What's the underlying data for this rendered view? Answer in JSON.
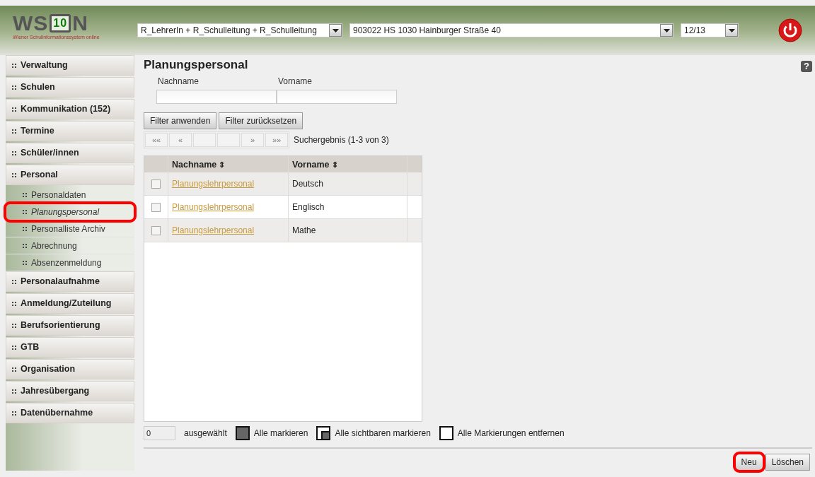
{
  "header": {
    "logo": {
      "text_left": "WS",
      "badge": "10",
      "text_right": "N",
      "tagline": "Wiener Schulinformationssystem online"
    },
    "selects": [
      {
        "value": "R_LehrerIn + R_Schulleitung + R_Schulleitung"
      },
      {
        "value": "903022 HS 1030 Hainburger Straße 40"
      },
      {
        "value": "12/13"
      }
    ]
  },
  "sidebar": {
    "items": [
      {
        "label": "Verwaltung",
        "selected": false
      },
      {
        "label": "Schulen",
        "selected": false
      },
      {
        "label": "Kommunikation (152)",
        "selected": false
      },
      {
        "label": "Termine",
        "selected": false
      },
      {
        "label": "Schüler/innen",
        "selected": false
      },
      {
        "label": "Personal",
        "selected": false,
        "children": [
          {
            "label": "Personaldaten",
            "selected": false,
            "highlighted": false
          },
          {
            "label": "Planungspersonal",
            "selected": true,
            "highlighted": true
          },
          {
            "label": "Personalliste Archiv",
            "selected": false,
            "highlighted": false
          },
          {
            "label": "Abrechnung",
            "selected": false,
            "highlighted": false
          },
          {
            "label": "Absenzenmeldung",
            "selected": false,
            "highlighted": false
          }
        ]
      },
      {
        "label": "Personalaufnahme",
        "selected": false
      },
      {
        "label": "Anmeldung/Zuteilung",
        "selected": false
      },
      {
        "label": "Berufsorientierung",
        "selected": false
      },
      {
        "label": "GTB",
        "selected": false
      },
      {
        "label": "Organisation",
        "selected": false
      },
      {
        "label": "Jahresübergang",
        "selected": false
      },
      {
        "label": "Datenübernahme",
        "selected": false
      }
    ]
  },
  "main": {
    "title": "Planungspersonal",
    "help": "?",
    "filters": [
      {
        "label": "Nachname"
      },
      {
        "label": "Vorname"
      }
    ],
    "filter_buttons": [
      "Filter anwenden",
      "Filter zurücksetzen"
    ],
    "pager": {
      "buttons": [
        {
          "label": "««",
          "disabled": true
        },
        {
          "label": "«",
          "disabled": true
        },
        {
          "disabled": true
        },
        {
          "disabled": true
        },
        {
          "label": "»",
          "disabled": true
        },
        {
          "label": "»»",
          "disabled": true
        }
      ],
      "result": "Suchergebnis (1-3 von 3)"
    },
    "table": {
      "columns": [
        {
          "label": "Nachname",
          "sort": "⇕"
        },
        {
          "label": "Vorname",
          "sort": "⇕"
        }
      ],
      "rows": [
        {
          "checked": false,
          "nachname": "Planungslehrpersonal",
          "vorname": "Deutsch"
        },
        {
          "checked": false,
          "nachname": "Planungslehrpersonal",
          "vorname": "Englisch"
        },
        {
          "checked": false,
          "nachname": "Planungslehrpersonal",
          "vorname": "Mathe"
        }
      ]
    },
    "selection": {
      "count": "0",
      "label": "ausgewählt",
      "actions": [
        {
          "kind": "all",
          "label": "Alle markieren"
        },
        {
          "kind": "visible",
          "label": "Alle sichtbaren markieren"
        },
        {
          "kind": "none",
          "label": "Alle Markierungen entfernen"
        }
      ]
    },
    "buttons": [
      {
        "label": "Neu",
        "highlighted": true
      },
      {
        "label": "Löschen",
        "highlighted": false
      }
    ]
  }
}
